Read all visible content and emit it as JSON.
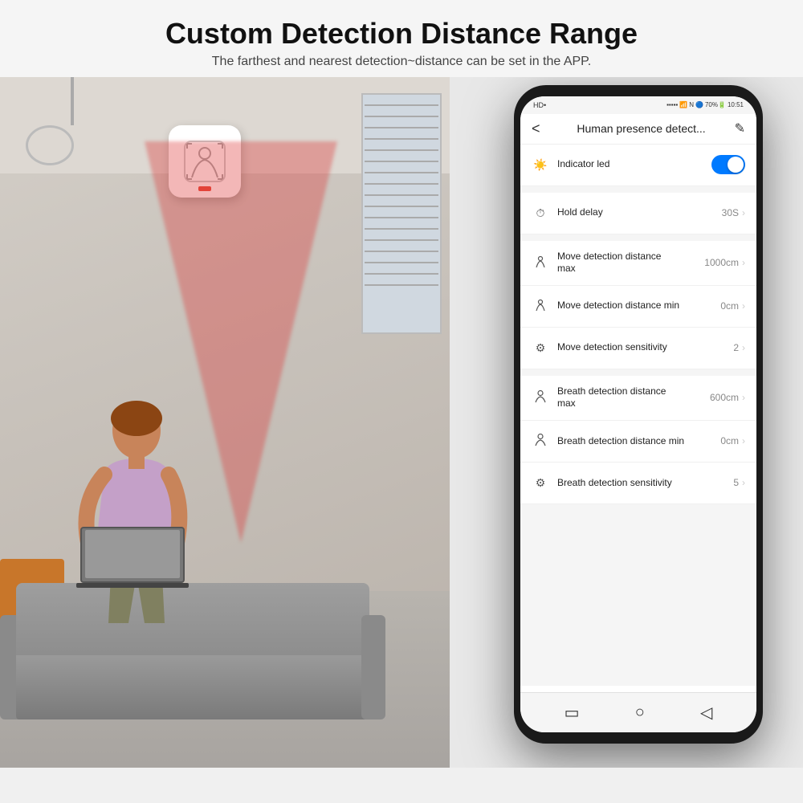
{
  "header": {
    "title": "Custom Detection Distance Range",
    "subtitle": "The farthest and nearest detection~distance can be set in the APP."
  },
  "phone": {
    "status_bar": {
      "left": "HD•",
      "signal": "..llll",
      "wifi": "WiFi",
      "right_icons": "N  🔊 70%",
      "time": "10:51"
    },
    "app_title": "Human presence detect...",
    "back_icon": "<",
    "edit_icon": "✎",
    "settings": [
      {
        "icon": "☀",
        "label": "Indicator led",
        "type": "toggle",
        "toggle_on": true
      },
      {
        "icon": "⏱",
        "label": "Hold delay",
        "value": "30S",
        "type": "arrow"
      },
      {
        "icon": "🚶",
        "label": "Move detection distance max",
        "value": "1000cm",
        "type": "arrow"
      },
      {
        "icon": "🚶",
        "label": "Move detection distance min",
        "value": "0cm",
        "type": "arrow"
      },
      {
        "icon": "⚙",
        "label": "Move detection sensitivity",
        "value": "2",
        "type": "arrow"
      },
      {
        "icon": "👤",
        "label": "Breath detection distance max",
        "value": "600cm",
        "type": "arrow"
      },
      {
        "icon": "👤",
        "label": "Breath detection distance min",
        "value": "0cm",
        "type": "arrow"
      },
      {
        "icon": "⚙",
        "label": "Breath detection sensitivity",
        "value": "5",
        "type": "arrow"
      }
    ],
    "bottom_nav": [
      "▭",
      "○",
      "◁"
    ]
  },
  "device": {
    "description": "Human presence sensor device on wall"
  }
}
